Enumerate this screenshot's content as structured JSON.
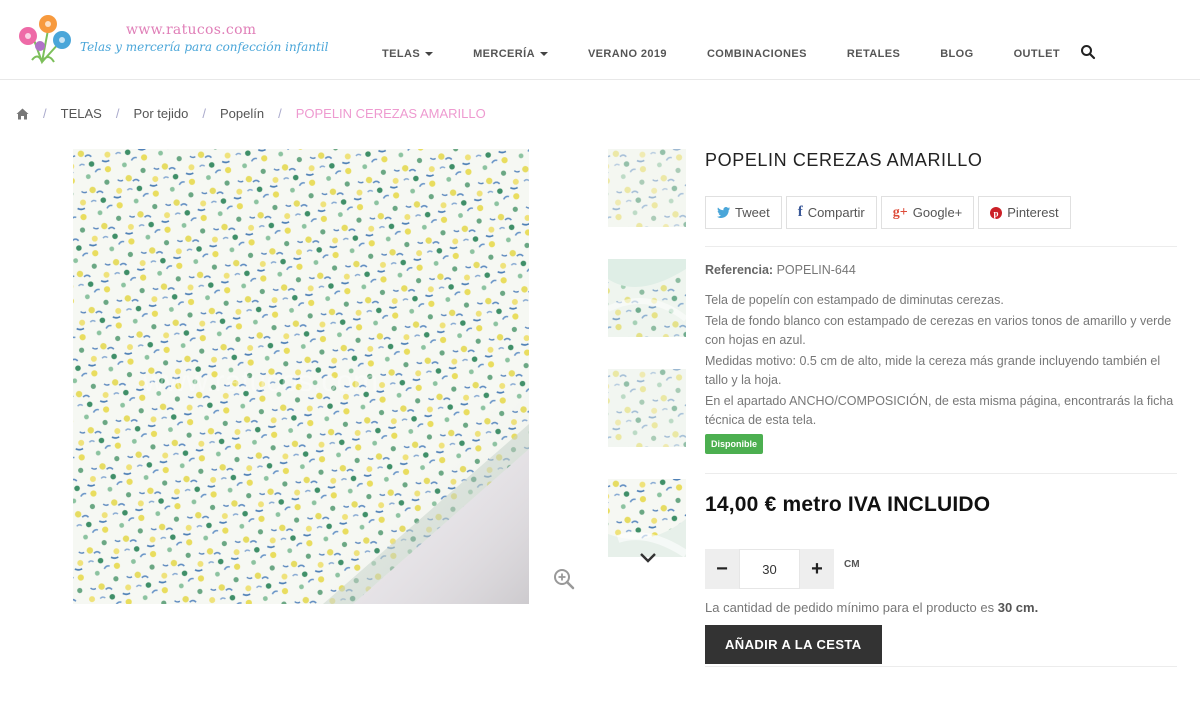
{
  "site": {
    "url": "www.ratucos.com",
    "tagline": "Telas y mercería para confección infantil"
  },
  "nav": {
    "items": [
      {
        "label": "TELAS",
        "dropdown": true
      },
      {
        "label": "MERCERÍA",
        "dropdown": true
      },
      {
        "label": "VERANO 2019",
        "dropdown": false
      },
      {
        "label": "COMBINACIONES",
        "dropdown": false
      },
      {
        "label": "RETALES",
        "dropdown": false
      },
      {
        "label": "BLOG",
        "dropdown": false
      },
      {
        "label": "OUTLET",
        "dropdown": false
      }
    ]
  },
  "breadcrumb": {
    "items": [
      "TELAS",
      "Por tejido",
      "Popelín"
    ],
    "current": "POPELIN CEREZAS AMARILLO"
  },
  "product": {
    "title": "POPELIN CEREZAS AMARILLO",
    "share": [
      {
        "label": "Tweet",
        "icon": "twitter-icon",
        "color": "#4aa6d9"
      },
      {
        "label": "Compartir",
        "icon": "facebook-icon",
        "color": "#3b5998"
      },
      {
        "label": "Google+",
        "icon": "google-plus-icon",
        "color": "#dd4b39"
      },
      {
        "label": "Pinterest",
        "icon": "pinterest-icon",
        "color": "#cb2027"
      }
    ],
    "reference_label": "Referencia:",
    "reference_value": "POPELIN-644",
    "description": [
      "Tela de popelín con estampado de diminutas cerezas.",
      "Tela de fondo blanco con estampado de cerezas en varios tonos de amarillo y verde con hojas en azul.",
      "Medidas motivo: 0.5 cm de alto, mide la cereza más grande incluyendo también el tallo y la hoja.",
      "En el apartado ANCHO/COMPOSICIÓN, de esta misma página, encontrarás la ficha técnica de esta tela."
    ],
    "availability": "Disponible",
    "price": "14,00 € metro IVA INCLUIDO",
    "quantity": "30",
    "quantity_unit": "CM",
    "min_note_prefix": "La cantidad de pedido mínimo para el producto es",
    "min_note_value": "30 cm.",
    "add_to_cart": "AÑADIR A LA CESTA",
    "image_watermark": "www.ratucos.com"
  },
  "colors": {
    "accent_pink": "#ee9ad0",
    "accent_blue": "#4aa6d9",
    "badge_green": "#4caf50",
    "cart_button": "#333333"
  }
}
